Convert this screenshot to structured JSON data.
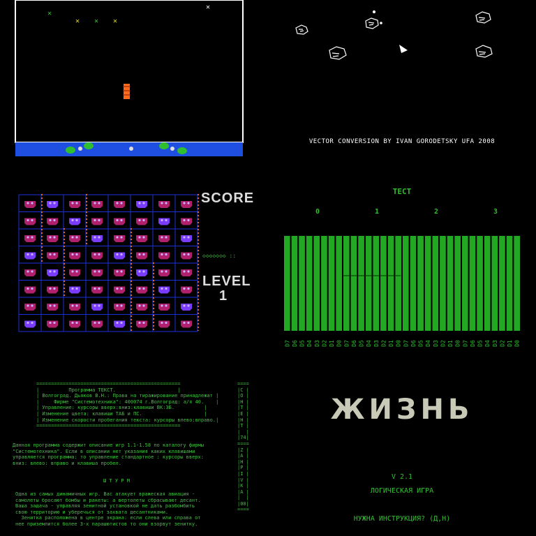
{
  "panels": {
    "frogger": {
      "colors": {
        "field": "#ffffff",
        "river": "#1f4fe0",
        "frog": "#ff6a1a",
        "pad": "#2fbf2f"
      }
    },
    "asteroids": {
      "credit": "VECTOR CONVERSION BY IVAN GORODETSKY UFA 2008"
    },
    "invaders": {
      "score_label": "SCORE",
      "level_label": "LEVEL",
      "level_value": "1",
      "grid": {
        "rows": 8,
        "cols": 8
      },
      "colors": {
        "grid": "#1c2fd8",
        "alien": "#b0206c",
        "eyes": "#6a4cff"
      }
    },
    "test": {
      "title": "ТЕСТ",
      "columns": [
        "0",
        "1",
        "2",
        "3"
      ],
      "bar_labels": [
        "D7",
        "D6",
        "D5",
        "D4",
        "D3",
        "D2",
        "D1",
        "D0",
        "D7",
        "D6",
        "D5",
        "D4",
        "D3",
        "D2",
        "D1",
        "D0",
        "D7",
        "D6",
        "D5",
        "D4",
        "D3",
        "D2",
        "D1",
        "D0",
        "D7",
        "D6",
        "D5",
        "D4",
        "D3",
        "D2",
        "D1",
        "D0"
      ],
      "bar_color": "#22a822"
    },
    "document": {
      "header_lines": [
        "=================================================",
        "|          Программа ТЕКСТ.                     |",
        "| Волгоград. Дьяков В.Н.: Права на тиражирование принадлежат |",
        "|     Фирме \"Системотехника\": 400074 г.Волгоград: а/я 40.    |",
        "| Управление: курсоры вверх:вниз:клавиши ВК:ЗБ.          |",
        "| Изменение цвета: клавиши ТАБ и ПС.                     |",
        "| Изменение скорости пробегания текста: курсоры влево:вправо.|",
        "================================================="
      ],
      "right_column": [
        "====",
        "|С |",
        "|О |",
        "|Н |",
        "|Т |",
        "|Е |",
        "|Н |",
        "|Т |",
        "|  |",
        "|74|",
        "====",
        "|Z |",
        "|А |",
        "|Н |",
        "|Р |",
        "|I |",
        "|V |",
        "|K |",
        "|A |",
        "|  |",
        "|00|",
        "===="
      ],
      "body_lines": [
        "Данная программа содержит описание игр 1.1-1.58 по каталогу фирмы",
        "\"Системотехника\". Если в описании нет указания каких клавишами",
        "управляется программа: то управление стандартное : курсоры вверх:",
        "вниз: влево: вправо и клавиша пробел."
      ],
      "section_title": "Ш Т У Р М",
      "body2_lines": [
        "Одна из самых динамичных игр. Вас атакует вражеская авиация -",
        "самолеты бросают бомбы и ракеты: а вертолеты сбрасывают десант.",
        "Ваша задача - управляя зенитной установкой не дать разбомбить",
        "свою территорию и уберечься от захвата десантниками.",
        "  Зенитка расположена в центре экрана: если слева или справа от",
        "нее приземлится более 3-х парашютистов то они взорвут зенитку."
      ]
    },
    "life": {
      "title": "ЖИЗНЬ",
      "version": "V 2.1",
      "subtitle": "ЛОГИЧЕСКАЯ ИГРА",
      "prompt": "НУЖНА ИНСТРУКЦИЯ? (Д,Н)",
      "colors": {
        "title": "#c9c9b8",
        "text": "#30c030"
      }
    }
  }
}
